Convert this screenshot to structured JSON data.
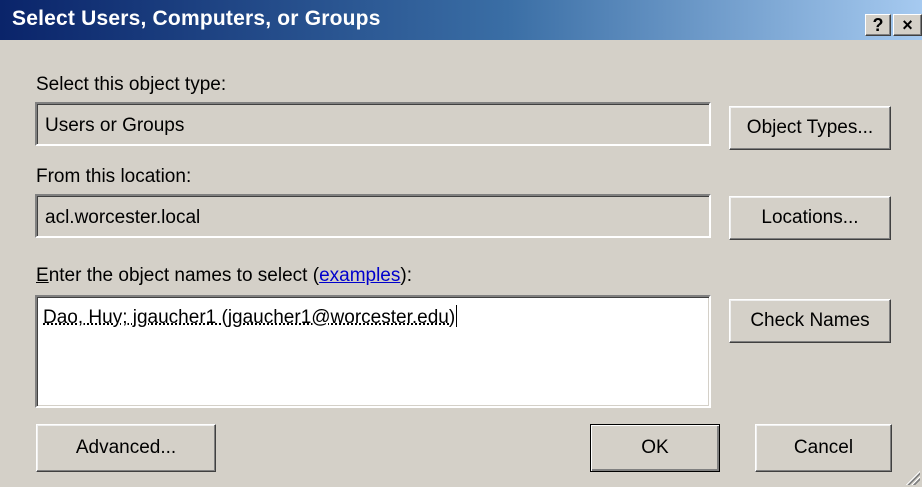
{
  "window": {
    "title": "Select Users, Computers, or Groups",
    "help_button": "?",
    "close_button": "×"
  },
  "object_type": {
    "label": "Select this object type:",
    "value": "Users or Groups",
    "button": "Object Types..."
  },
  "location": {
    "label": "From this location:",
    "value": "acl.worcester.local",
    "button": "Locations..."
  },
  "names": {
    "label_prefix": "nter the object names to select (",
    "label_accel": "E",
    "label_link": "examples",
    "label_suffix": "):",
    "value": "Dao, Huy; jgaucher1 (jgaucher1@worcester.edu)",
    "button": "Check Names"
  },
  "footer": {
    "advanced": "Advanced...",
    "ok": "OK",
    "cancel": "Cancel"
  }
}
